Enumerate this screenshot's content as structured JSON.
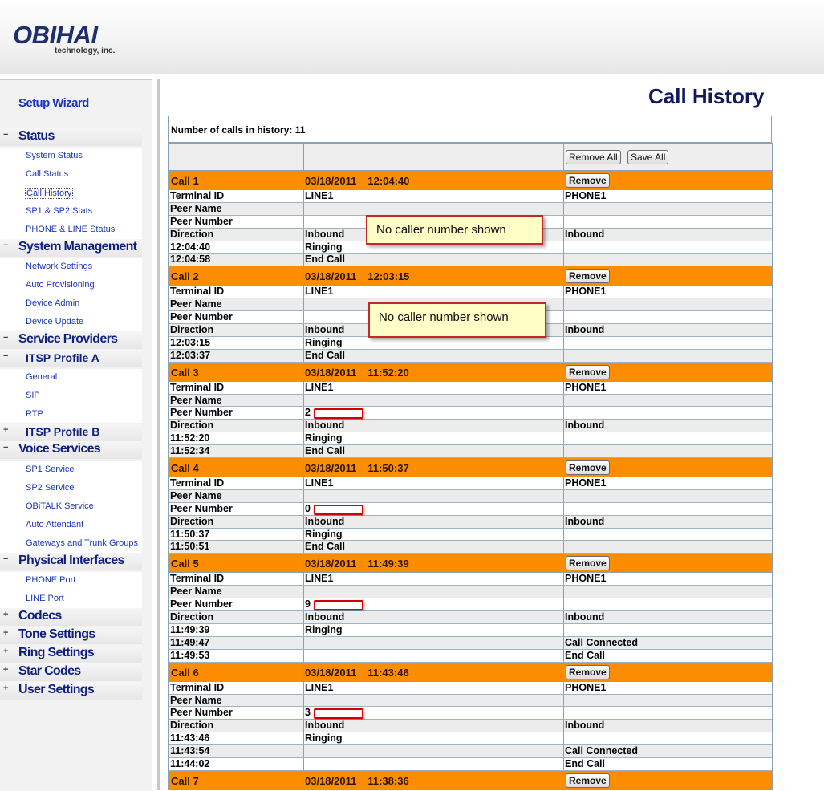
{
  "brand": {
    "logo": "OBIHAI",
    "sub": "technology, inc."
  },
  "sidebar": {
    "setup_wizard": "Setup Wizard",
    "toggle_open": "−",
    "toggle_closed": "+",
    "sections": [
      {
        "label": "Status",
        "items": [
          "System Status",
          "Call Status",
          "Call History",
          "SP1 & SP2 Stats",
          "PHONE & LINE Status"
        ]
      },
      {
        "label": "System Management",
        "items": [
          "Network Settings",
          "Auto Provisioning",
          "Device Admin",
          "Device Update"
        ]
      },
      {
        "label": "Service Providers",
        "sub": [
          {
            "label": "ITSP Profile A",
            "items": [
              "General",
              "SIP",
              "RTP"
            ]
          },
          {
            "label": "ITSP Profile B"
          }
        ]
      },
      {
        "label": "Voice Services",
        "items": [
          "SP1 Service",
          "SP2 Service",
          "OBiTALK Service",
          "Auto Attendant",
          "Gateways and Trunk Groups"
        ]
      },
      {
        "label": "Physical Interfaces",
        "items": [
          "PHONE Port",
          "LINE Port"
        ]
      },
      {
        "label": "Codecs"
      },
      {
        "label": "Tone Settings"
      },
      {
        "label": "Ring Settings"
      },
      {
        "label": "Star Codes"
      },
      {
        "label": "User Settings"
      }
    ]
  },
  "main": {
    "title": "Call History",
    "count_text": "Number of calls in history: 11",
    "remove_all": "Remove All",
    "save_all": "Save All",
    "remove": "Remove"
  },
  "calls": [
    {
      "name": "Call 1",
      "date": "03/18/2011",
      "time": "12:04:40",
      "rows": [
        [
          "Terminal ID",
          "LINE1",
          "PHONE1"
        ],
        [
          "Peer Name",
          "",
          ""
        ],
        [
          "Peer Number",
          "",
          ""
        ],
        [
          "Direction",
          "Inbound",
          "Inbound"
        ],
        [
          "12:04:40",
          "Ringing",
          ""
        ],
        [
          "12:04:58",
          "End Call",
          ""
        ]
      ]
    },
    {
      "name": "Call 2",
      "date": "03/18/2011",
      "time": "12:03:15",
      "rows": [
        [
          "Terminal ID",
          "LINE1",
          "PHONE1"
        ],
        [
          "Peer Name",
          "",
          ""
        ],
        [
          "Peer Number",
          "",
          ""
        ],
        [
          "Direction",
          "Inbound",
          "Inbound"
        ],
        [
          "12:03:15",
          "Ringing",
          ""
        ],
        [
          "12:03:37",
          "End Call",
          ""
        ]
      ]
    },
    {
      "name": "Call 3",
      "date": "03/18/2011",
      "time": "11:52:20",
      "rows": [
        [
          "Terminal ID",
          "LINE1",
          "PHONE1"
        ],
        [
          "Peer Name",
          "",
          ""
        ],
        [
          "Peer Number",
          "2",
          ""
        ],
        [
          "Direction",
          "Inbound",
          "Inbound"
        ],
        [
          "11:52:20",
          "Ringing",
          ""
        ],
        [
          "11:52:34",
          "End Call",
          ""
        ]
      ]
    },
    {
      "name": "Call 4",
      "date": "03/18/2011",
      "time": "11:50:37",
      "rows": [
        [
          "Terminal ID",
          "LINE1",
          "PHONE1"
        ],
        [
          "Peer Name",
          "",
          ""
        ],
        [
          "Peer Number",
          "0",
          ""
        ],
        [
          "Direction",
          "Inbound",
          "Inbound"
        ],
        [
          "11:50:37",
          "Ringing",
          ""
        ],
        [
          "11:50:51",
          "End Call",
          ""
        ]
      ]
    },
    {
      "name": "Call 5",
      "date": "03/18/2011",
      "time": "11:49:39",
      "rows": [
        [
          "Terminal ID",
          "LINE1",
          "PHONE1"
        ],
        [
          "Peer Name",
          "",
          ""
        ],
        [
          "Peer Number",
          "9",
          ""
        ],
        [
          "Direction",
          "Inbound",
          "Inbound"
        ],
        [
          "11:49:39",
          "Ringing",
          ""
        ],
        [
          "11:49:47",
          "",
          "Call Connected"
        ],
        [
          "11:49:53",
          "",
          "End Call"
        ]
      ]
    },
    {
      "name": "Call 6",
      "date": "03/18/2011",
      "time": "11:43:46",
      "rows": [
        [
          "Terminal ID",
          "LINE1",
          "PHONE1"
        ],
        [
          "Peer Name",
          "",
          ""
        ],
        [
          "Peer Number",
          "3",
          ""
        ],
        [
          "Direction",
          "Inbound",
          "Inbound"
        ],
        [
          "11:43:46",
          "Ringing",
          ""
        ],
        [
          "11:43:54",
          "",
          "Call Connected"
        ],
        [
          "11:44:02",
          "",
          "End Call"
        ]
      ]
    },
    {
      "name": "Call 7",
      "date": "03/18/2011",
      "time": "11:38:36",
      "rows": []
    }
  ],
  "callouts": [
    "No caller number shown",
    "No caller number shown"
  ]
}
